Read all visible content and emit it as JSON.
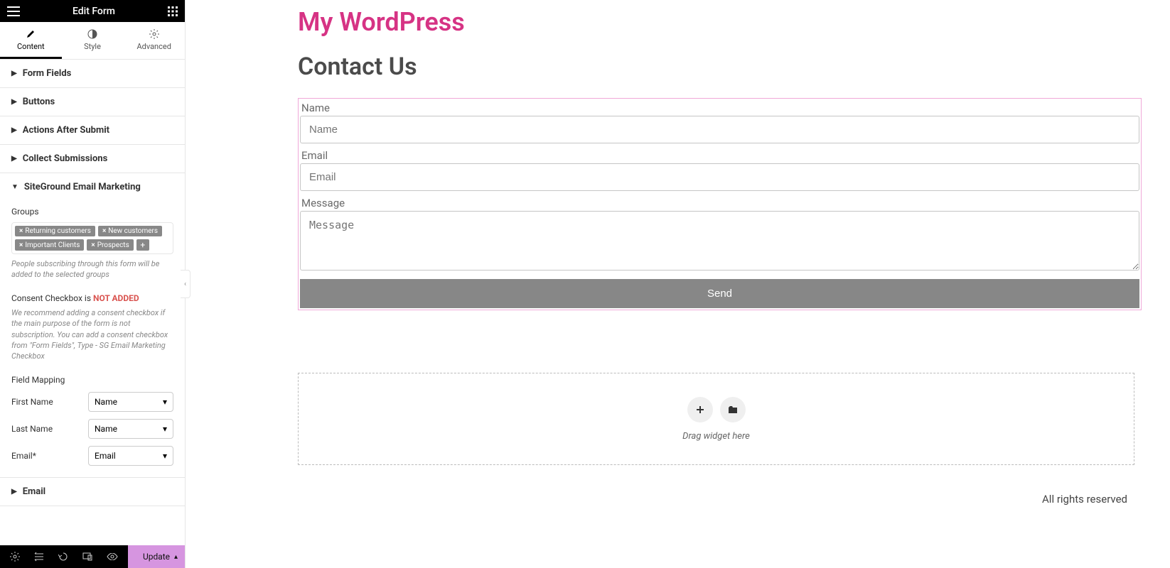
{
  "header": {
    "title": "Edit Form"
  },
  "tabs": {
    "content": "Content",
    "style": "Style",
    "advanced": "Advanced"
  },
  "accordion": {
    "form_fields": "Form Fields",
    "buttons": "Buttons",
    "actions_after_submit": "Actions After Submit",
    "collect_submissions": "Collect Submissions",
    "siteground": "SiteGround Email Marketing",
    "email": "Email"
  },
  "groups": {
    "label": "Groups",
    "tags": [
      "Returning customers",
      "New customers",
      "Important Clients",
      "Prospects"
    ],
    "help": "People subscribing through this form will be added to the selected groups"
  },
  "consent": {
    "label": "Consent Checkbox is ",
    "status": "NOT ADDED",
    "help": "We recommend adding a consent checkbox if the main purpose of the form is not subscription. You can add a consent checkbox from \"Form Fields\", Type - SG Email Marketing Checkbox"
  },
  "mapping": {
    "label": "Field Mapping",
    "rows": [
      {
        "label": "First Name",
        "value": "Name"
      },
      {
        "label": "Last Name",
        "value": "Name"
      },
      {
        "label": "Email*",
        "value": "Email"
      }
    ]
  },
  "footer": {
    "update": "Update"
  },
  "canvas": {
    "site_title": "My WordPress",
    "page_title": "Contact Us",
    "form": {
      "name_label": "Name",
      "name_placeholder": "Name",
      "email_label": "Email",
      "email_placeholder": "Email",
      "message_label": "Message",
      "message_placeholder": "Message",
      "send": "Send"
    },
    "drop_text": "Drag widget here",
    "rights": "All rights reserved"
  }
}
